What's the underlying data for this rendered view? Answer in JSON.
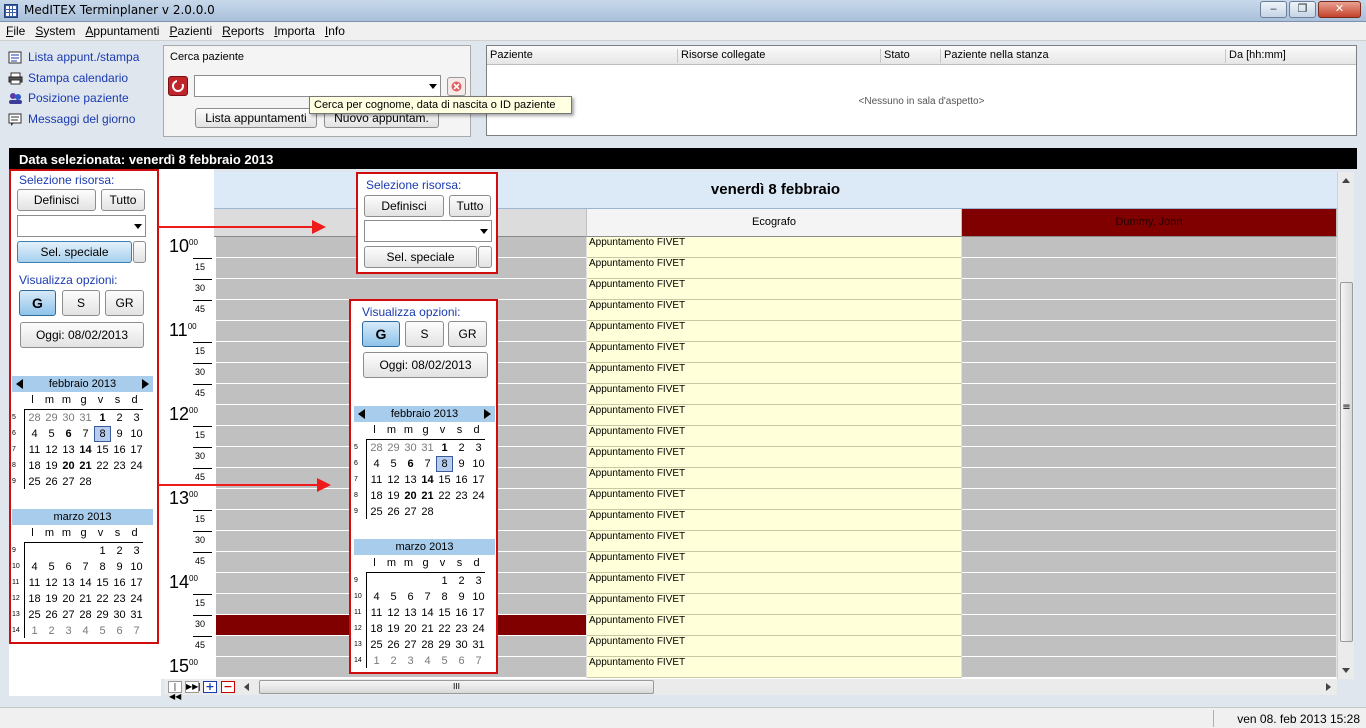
{
  "window": {
    "title": "MedITEX  Terminplaner v 2.0.0.0",
    "minimize_label": "‒",
    "maximize_label": "❐",
    "close_label": "✕"
  },
  "menu": [
    "File",
    "System",
    "Appuntamenti",
    "Pazienti",
    "Reports",
    "Importa",
    "Info"
  ],
  "quick_links": [
    {
      "label": "Lista appunt./stampa",
      "icon": "list-icon"
    },
    {
      "label": "Stampa calendario",
      "icon": "printer-icon"
    },
    {
      "label": "Posizione paziente",
      "icon": "people-icon"
    },
    {
      "label": "Messaggi del giorno",
      "icon": "message-icon"
    }
  ],
  "search": {
    "title": "Cerca paziente",
    "value": "",
    "list_button": "Lista appuntamenti",
    "new_button": "Nuovo appuntam.",
    "tooltip": "Cerca per cognome, data di nascita o ID paziente"
  },
  "waiting_room": {
    "columns": [
      "Paziente",
      "Risorse collegate",
      "Stato",
      "Paziente nella stanza",
      "Da [hh:mm]"
    ],
    "empty_text": "<Nessuno in sala d'aspetto>"
  },
  "date_header": "Data selezionata: venerdì 8 febbraio 2013",
  "resource_panel": {
    "title": "Selezione risorsa:",
    "define_button": "Definisci",
    "all_button": "Tutto",
    "special_button": "Sel. speciale"
  },
  "view_panel": {
    "title": "Visualizza opzioni:",
    "day_button": "G",
    "week_button": "S",
    "group_button": "GR",
    "today_button": "Oggi: 08/02/2013"
  },
  "calendars": {
    "weekdays": [
      "l",
      "m",
      "m",
      "g",
      "v",
      "s",
      "d"
    ],
    "feb": {
      "title": "febbraio 2013",
      "weeks": [
        "5",
        "6",
        "7",
        "8",
        "9"
      ],
      "rows": [
        [
          "28",
          "29",
          "30",
          "31",
          "1",
          "2",
          "3"
        ],
        [
          "4",
          "5",
          "6",
          "7",
          "8",
          "9",
          "10"
        ],
        [
          "11",
          "12",
          "13",
          "14",
          "15",
          "16",
          "17"
        ],
        [
          "18",
          "19",
          "20",
          "21",
          "22",
          "23",
          "24"
        ],
        [
          "25",
          "26",
          "27",
          "28",
          "",
          "",
          ""
        ]
      ]
    },
    "mar": {
      "title": "marzo 2013",
      "weeks": [
        "9",
        "10",
        "11",
        "12",
        "13",
        "14"
      ],
      "rows": [
        [
          "",
          "",
          "",
          "",
          "1",
          "2",
          "3"
        ],
        [
          "4",
          "5",
          "6",
          "7",
          "8",
          "9",
          "10"
        ],
        [
          "11",
          "12",
          "13",
          "14",
          "15",
          "16",
          "17"
        ],
        [
          "18",
          "19",
          "20",
          "21",
          "22",
          "23",
          "24"
        ],
        [
          "25",
          "26",
          "27",
          "28",
          "29",
          "30",
          "31"
        ],
        [
          "1",
          "2",
          "3",
          "4",
          "5",
          "6",
          "7"
        ]
      ]
    }
  },
  "schedule": {
    "day_title": "venerdì 8 febbraio",
    "resources": [
      "",
      "Ecografo",
      "Dummy, John"
    ],
    "hours": [
      "10",
      "11",
      "12",
      "13",
      "14",
      "15"
    ],
    "minutes_first": "00",
    "quarters": [
      "15",
      "30",
      "45"
    ],
    "appointment_label": "Appuntamento FIVET",
    "dark_slot_index": 18
  },
  "colors": {
    "resource_dark": "#800000",
    "appointment_bg": "#ffffd9",
    "slot_gray": "#c0c0c0",
    "annotation_red": "#d00c0c"
  },
  "hscroll_label": "III",
  "vscroll_label": "≡",
  "status_time": "ven 08. feb 2013 15:28"
}
